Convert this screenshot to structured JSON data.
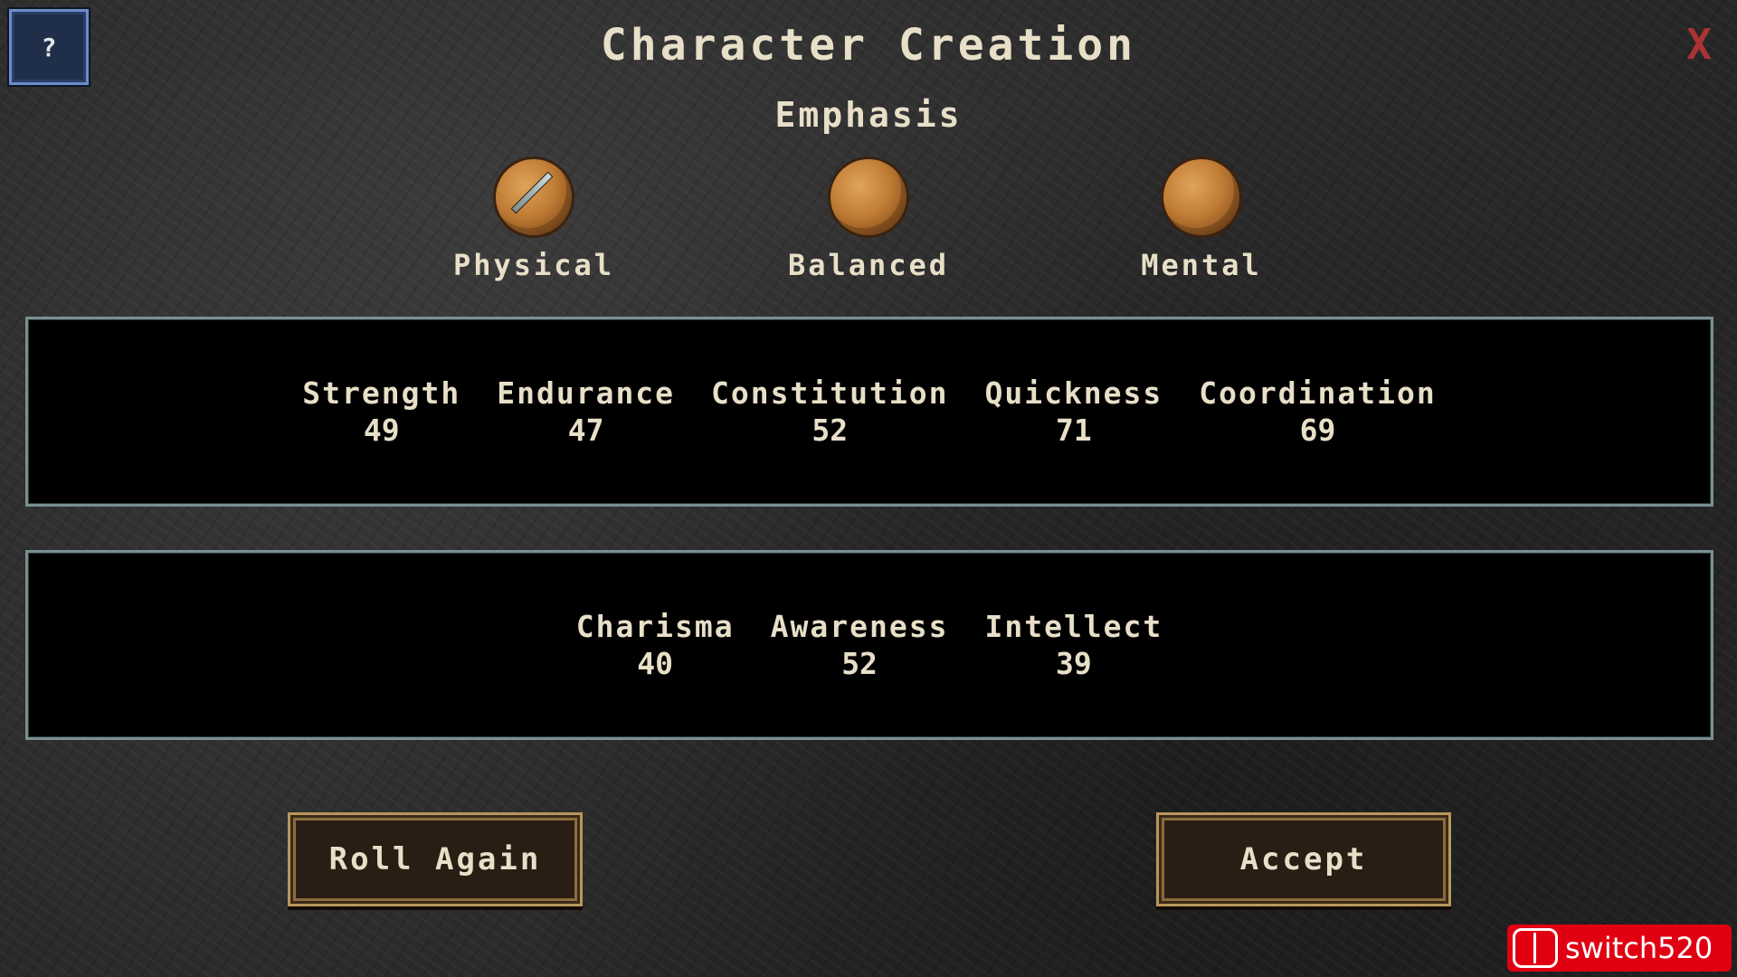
{
  "header": {
    "help_label": "?",
    "close_label": "X",
    "title": "Character Creation",
    "subtitle": "Emphasis"
  },
  "emphasis": {
    "options": [
      {
        "label": "Physical",
        "icon": "orb-sword-icon",
        "selected": true
      },
      {
        "label": "Balanced",
        "icon": "orb-icon",
        "selected": false
      },
      {
        "label": "Mental",
        "icon": "orb-icon",
        "selected": false
      }
    ]
  },
  "physical_stats": [
    {
      "name": "Strength",
      "value": "49"
    },
    {
      "name": "Endurance",
      "value": "47"
    },
    {
      "name": "Constitution",
      "value": "52"
    },
    {
      "name": "Quickness",
      "value": "71"
    },
    {
      "name": "Coordination",
      "value": "69"
    }
  ],
  "mental_stats": [
    {
      "name": "Charisma",
      "value": "40"
    },
    {
      "name": "Awareness",
      "value": "52"
    },
    {
      "name": "Intellect",
      "value": "39"
    }
  ],
  "actions": {
    "roll_label": "Roll Again",
    "accept_label": "Accept"
  },
  "watermark": {
    "text": "switch520"
  },
  "colors": {
    "text": "#e8dfc8",
    "close": "#aa3333",
    "panel_border": "#7a8f92",
    "button_border": "#b8975a"
  }
}
